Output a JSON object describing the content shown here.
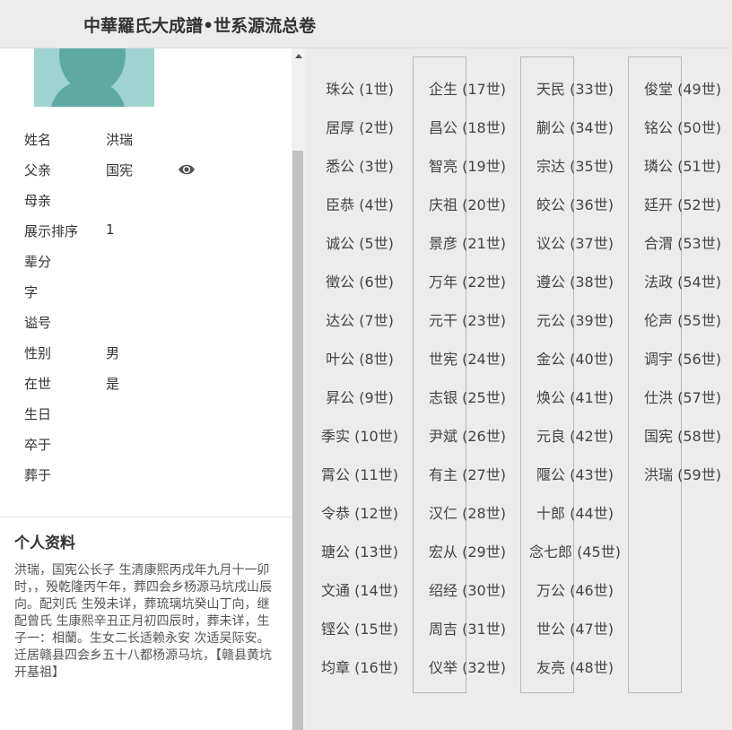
{
  "header": {
    "title": "中華羅氏大成譜•世系源流总卷"
  },
  "profile": {
    "fields": [
      {
        "label": "姓名",
        "value": "洪瑞"
      },
      {
        "label": "父亲",
        "value": "国宪"
      },
      {
        "label": "母亲",
        "value": ""
      },
      {
        "label": "展示排序",
        "value": "1"
      },
      {
        "label": "辈分",
        "value": ""
      },
      {
        "label": "字",
        "value": ""
      },
      {
        "label": "谥号",
        "value": ""
      },
      {
        "label": "性别",
        "value": "男"
      },
      {
        "label": "在世",
        "value": "是"
      },
      {
        "label": "生日",
        "value": ""
      },
      {
        "label": "卒于",
        "value": ""
      },
      {
        "label": "葬于",
        "value": ""
      }
    ],
    "view_icon": "eye-icon"
  },
  "personal": {
    "title": "个人资料",
    "bio": "洪瑞，国宪公长子 生清康熙丙戌年九月十一卯时，，殁乾隆丙午年，葬四会乡杨源马坑戌山辰向。配刘氏 生殁未详，葬琉璃坑癸山丁向，继配曾氏 生康熙辛丑正月初四辰时，葬未详，生子一：相蘭。生女二长适赖永安  次适吴际安。\n迁居赣县四会乡五十八都杨源马坑，【赣县黄坑开基祖】"
  },
  "lineage": {
    "generations": [
      "珠公 (1世)",
      "居厚 (2世)",
      "悉公 (3世)",
      "臣恭 (4世)",
      "诚公 (5世)",
      "徵公 (6世)",
      "达公 (7世)",
      "叶公 (8世)",
      "昇公 (9世)",
      "季实 (10世)",
      "霄公 (11世)",
      "令恭 (12世)",
      "瑭公 (13世)",
      "文通 (14世)",
      "铿公 (15世)",
      "均章 (16世)",
      "企生 (17世)",
      "昌公 (18世)",
      "智亮 (19世)",
      "庆祖 (20世)",
      "景彦 (21世)",
      "万年 (22世)",
      "元干 (23世)",
      "世宪 (24世)",
      "志银 (25世)",
      "尹斌 (26世)",
      "有主 (27世)",
      "汉仁 (28世)",
      "宏从 (29世)",
      "绍经 (30世)",
      "周吉 (31世)",
      "仪举 (32世)",
      "天民 (33世)",
      "蒯公 (34世)",
      "宗达 (35世)",
      "皎公 (36世)",
      "议公 (37世)",
      "遵公 (38世)",
      "元公 (39世)",
      "金公 (40世)",
      "焕公 (41世)",
      "元良 (42世)",
      "隁公 (43世)",
      "十郎 (44世)",
      "念七郎 (45世)",
      "万公 (46世)",
      "世公 (47世)",
      "友亮 (48世)",
      "俊堂 (49世)",
      "铭公 (50世)",
      "璘公 (51世)",
      "廷开 (52世)",
      "合渭 (53世)",
      "法政 (54世)",
      "伦声 (55世)",
      "调宇 (56世)",
      "仕洪 (57世)",
      "国宪 (58世)",
      "洪瑞 (59世)"
    ]
  }
}
